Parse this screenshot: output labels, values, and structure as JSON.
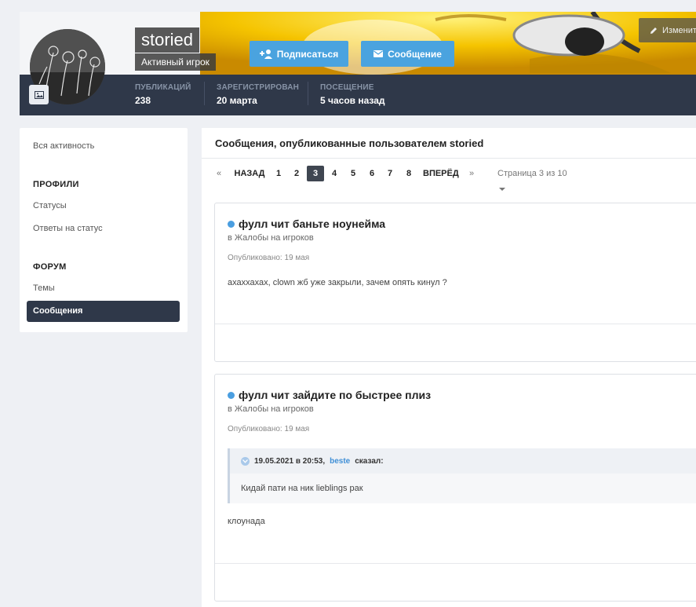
{
  "profile": {
    "username": "storied",
    "user_title": "Активный игрок",
    "follow_label": "Подписаться",
    "message_label": "Сообщение",
    "edit_label": "Изменить",
    "stats": [
      {
        "label": "ПУБЛИКАЦИЙ",
        "value": "238"
      },
      {
        "label": "ЗАРЕГИСТРИРОВАН",
        "value": "20 марта"
      },
      {
        "label": "ПОСЕЩЕНИЕ",
        "value": "5 часов назад"
      }
    ]
  },
  "sidebar": {
    "all_activity": "Вся активность",
    "profiles_heading": "ПРОФИЛИ",
    "statuses": "Статусы",
    "status_replies": "Ответы на статус",
    "forum_heading": "ФОРУМ",
    "topics": "Темы",
    "messages": "Сообщения"
  },
  "main": {
    "title": "Сообщения, опубликованные пользователем storied",
    "pager": {
      "first": "«",
      "prev": "НАЗАД",
      "pages": [
        "1",
        "2",
        "3",
        "4",
        "5",
        "6",
        "7",
        "8"
      ],
      "current": "3",
      "next": "ВПЕРЁД",
      "last": "»",
      "page_of": "Страница 3 из 10"
    },
    "posts": [
      {
        "title": "фулл чит баньте ноунейма",
        "forum": "в Жалобы на игроков",
        "meta": "Опубликовано: 19 мая",
        "body": "ахаххахах, clown жб уже закрыли, зачем опять кинул ?"
      },
      {
        "title": "фулл чит зайдите по быстрее плиз",
        "forum": "в Жалобы на игроков",
        "meta": "Опубликовано: 19 мая",
        "quote_date": "19.05.2021 в 20:53,",
        "quote_author": "beste",
        "quote_said": "сказал:",
        "quote_text": "Кидай пати на ник lieblings рак",
        "body": "клоунада"
      }
    ]
  },
  "colors": {
    "accent": "#4aa3df",
    "dark": "#2f3849",
    "online_dot": "#4a9ee0"
  }
}
